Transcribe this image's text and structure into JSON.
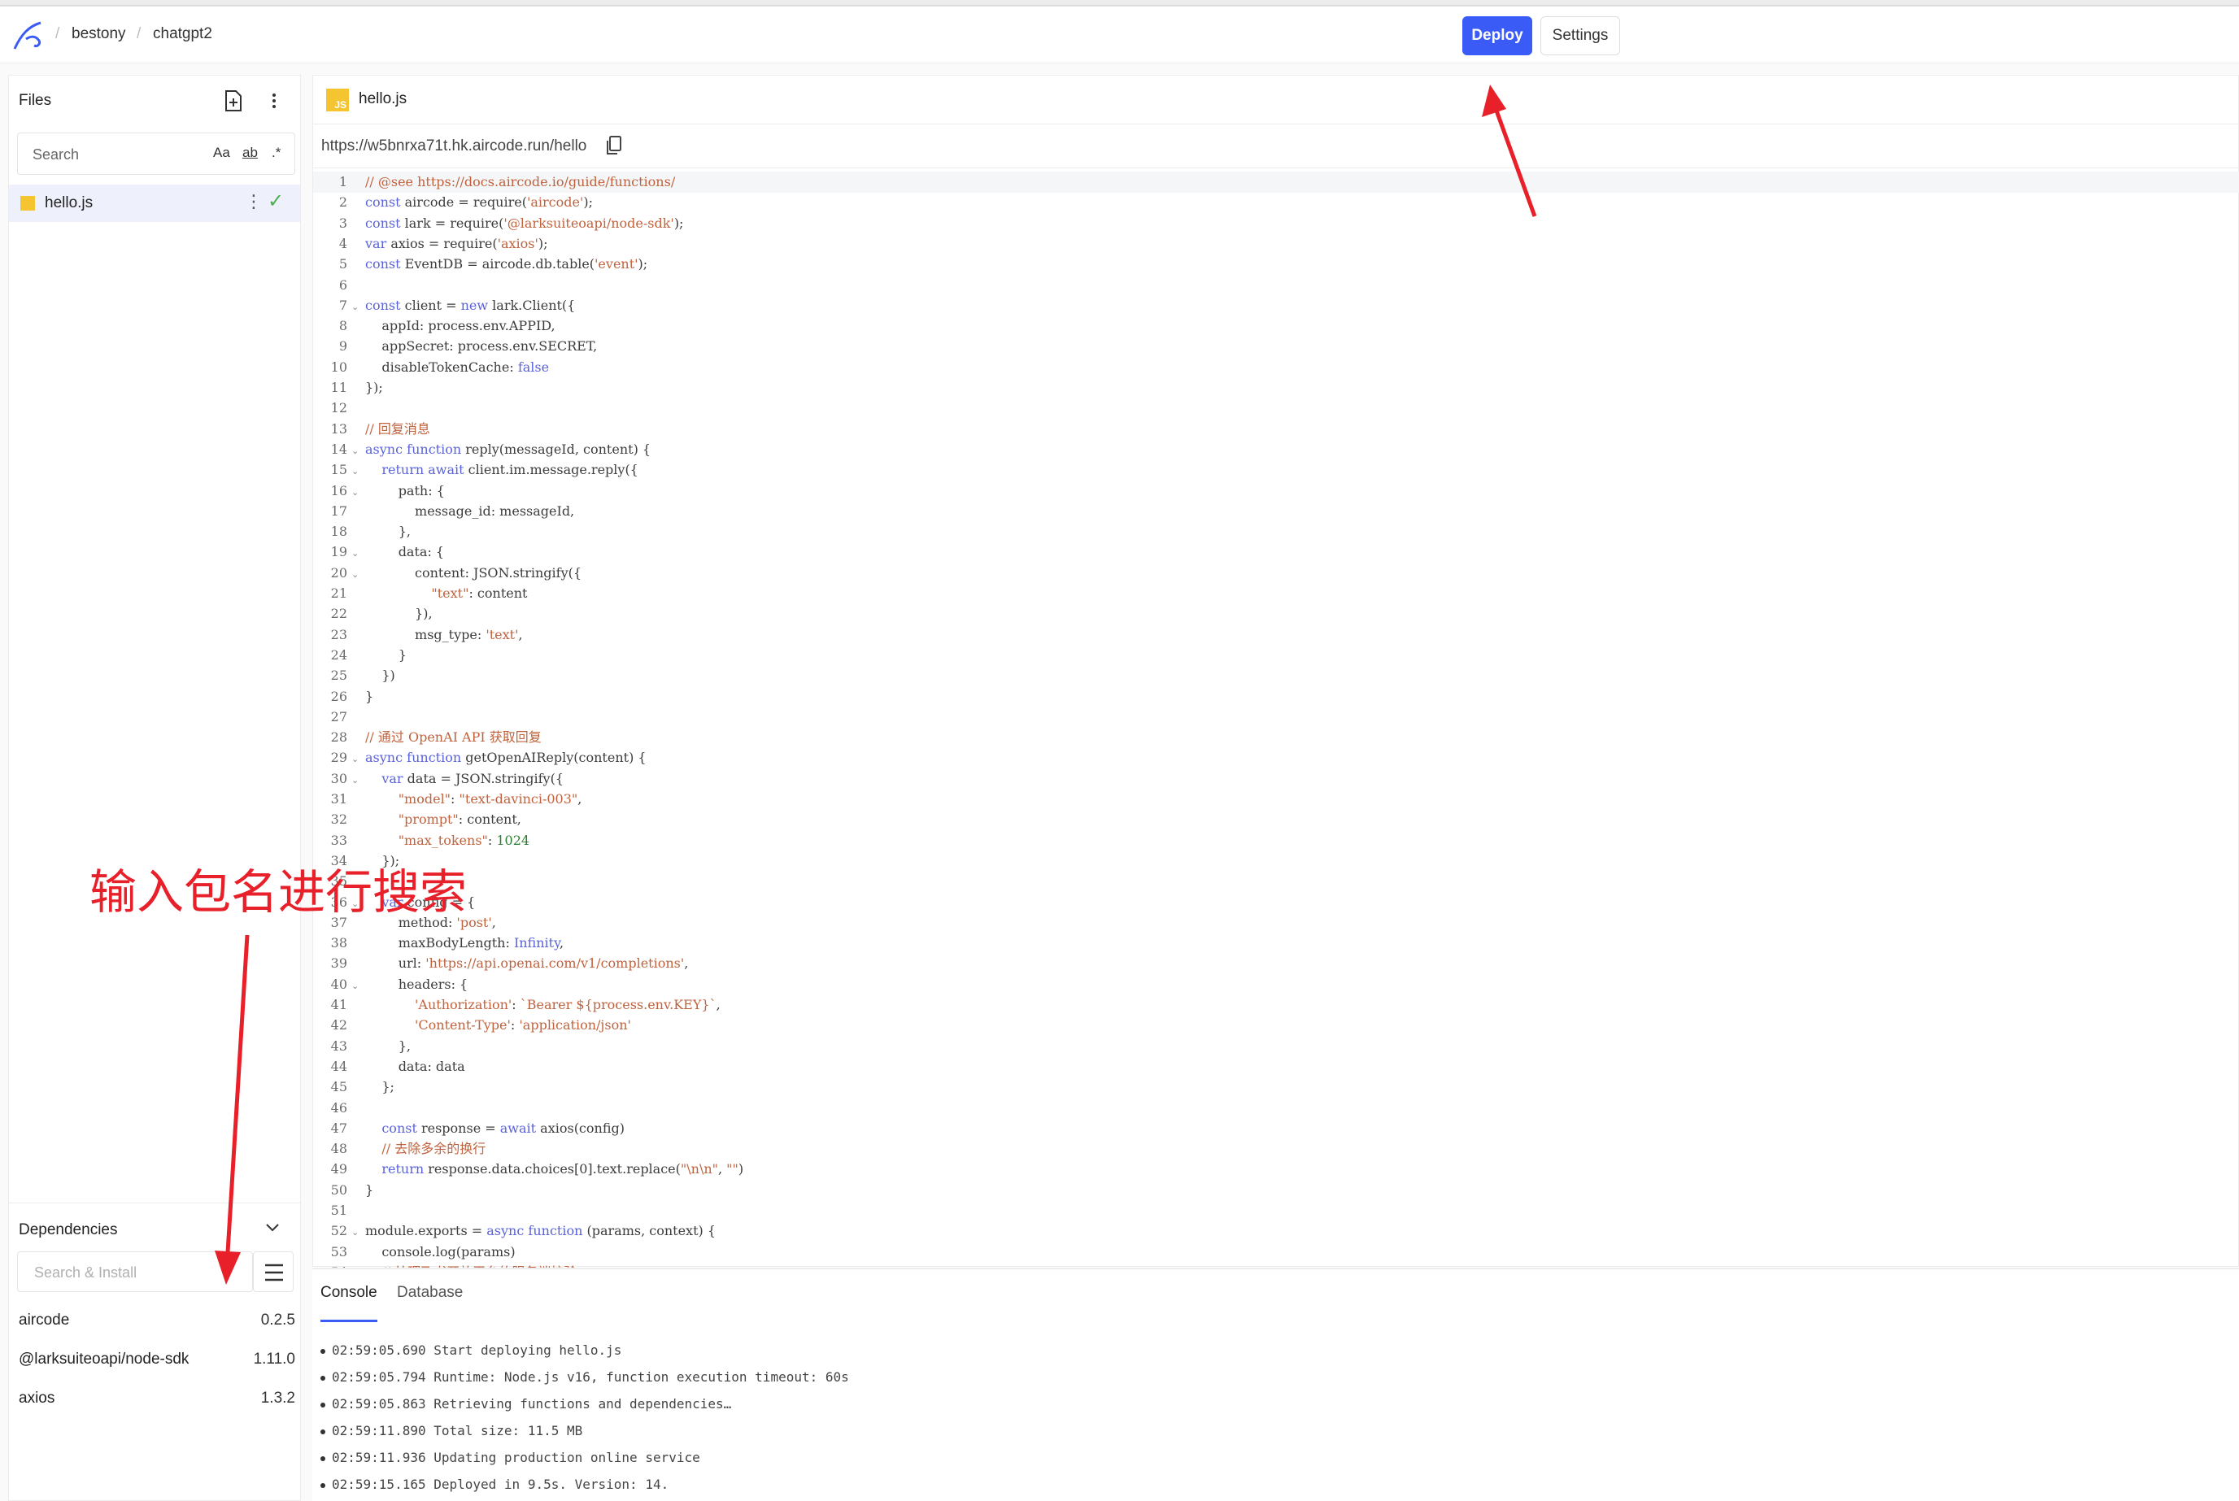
{
  "breadcrumb": {
    "items": [
      "bestony",
      "chatgpt2"
    ]
  },
  "header": {
    "deploy_label": "Deploy",
    "settings_label": "Settings"
  },
  "files": {
    "title": "Files",
    "search_placeholder": "Search",
    "search_options": [
      "Aa",
      "ab",
      ".*"
    ],
    "items": [
      {
        "name": "hello.js"
      }
    ]
  },
  "dependencies": {
    "title": "Dependencies",
    "search_placeholder": "Search & Install",
    "items": [
      {
        "name": "aircode",
        "version": "0.2.5"
      },
      {
        "name": "@larksuiteoapi/node-sdk",
        "version": "1.11.0"
      },
      {
        "name": "axios",
        "version": "1.3.2"
      }
    ]
  },
  "editor": {
    "tab_name": "hello.js",
    "file_badge": "JS",
    "url": "https://w5bnrxa71t.hk.aircode.run/hello",
    "folds": [
      7,
      14,
      15,
      16,
      19,
      20,
      29,
      30,
      36,
      40,
      52
    ],
    "lines": [
      "// @see https://docs.aircode.io/guide/functions/",
      "const aircode = require('aircode');",
      "const lark = require('@larksuiteoapi/node-sdk');",
      "var axios = require('axios');",
      "const EventDB = aircode.db.table('event');",
      "",
      "const client = new lark.Client({",
      "    appId: process.env.APPID,",
      "    appSecret: process.env.SECRET,",
      "    disableTokenCache: false",
      "});",
      "",
      "// 回复消息",
      "async function reply(messageId, content) {",
      "    return await client.im.message.reply({",
      "        path: {",
      "            message_id: messageId,",
      "        },",
      "        data: {",
      "            content: JSON.stringify({",
      "                \"text\": content",
      "            }),",
      "            msg_type: 'text',",
      "        }",
      "    })",
      "}",
      "",
      "// 通过 OpenAI API 获取回复",
      "async function getOpenAIReply(content) {",
      "    var data = JSON.stringify({",
      "        \"model\": \"text-davinci-003\",",
      "        \"prompt\": content,",
      "        \"max_tokens\": 1024",
      "    });",
      "",
      "    var config = {",
      "        method: 'post',",
      "        maxBodyLength: Infinity,",
      "        url: 'https://api.openai.com/v1/completions',",
      "        headers: {",
      "            'Authorization': `Bearer ${process.env.KEY}`,",
      "            'Content-Type': 'application/json'",
      "        },",
      "        data: data",
      "    };",
      "",
      "    const response = await axios(config)",
      "    // 去除多余的换行",
      "    return response.data.choices[0].text.replace(\"\\n\\n\", \"\")",
      "}",
      "",
      "module.exports = async function (params, context) {",
      "    console.log(params)",
      "    // 处理飞书开放平台的服务端校验"
    ]
  },
  "console": {
    "tabs": [
      "Console",
      "Database"
    ],
    "logs": [
      "02:59:05.690 Start deploying hello.js",
      "02:59:05.794 Runtime: Node.js v16, function execution timeout: 60s",
      "02:59:05.863 Retrieving functions and dependencies…",
      "02:59:11.890 Total size: 11.5 MB",
      "02:59:11.936 Updating production online service",
      "02:59:15.165 Deployed in 9.5s. Version: 14."
    ]
  },
  "annotation": {
    "text": "输入包名进行搜索",
    "color": "#e8202a"
  },
  "colors": {
    "accent": "#3b5bf6",
    "annotation": "#e8202a",
    "js_badge": "#f4c531"
  }
}
